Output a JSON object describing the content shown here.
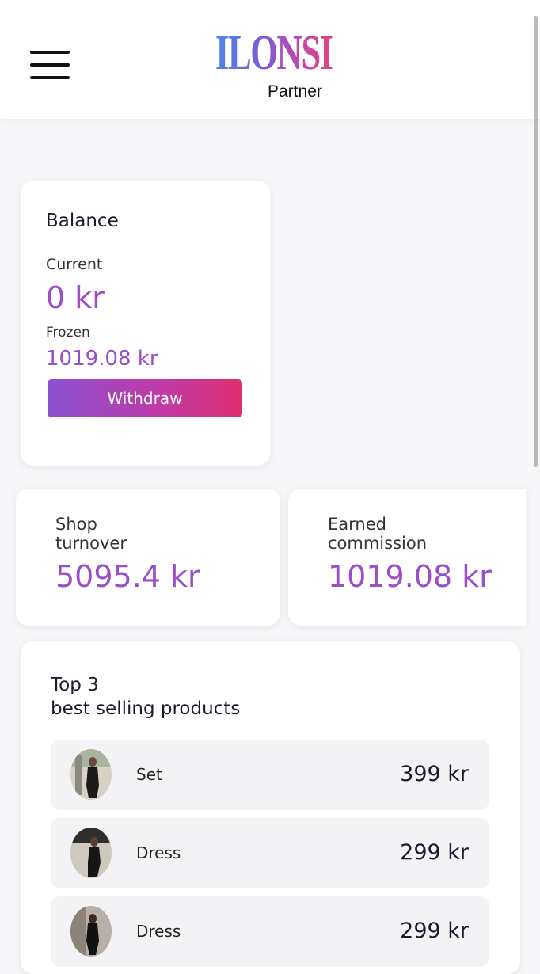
{
  "header": {
    "logo_text": "ILONSI",
    "logo_subtitle": "Partner",
    "menu_icon": "hamburger-menu-icon"
  },
  "balance": {
    "title": "Balance",
    "current_label": "Current",
    "current_value": "0 kr",
    "frozen_label": "Frozen",
    "frozen_value": "1019.08 kr",
    "withdraw_label": "Withdraw"
  },
  "stats": {
    "shop_turnover_label": "Shop\nturnover",
    "shop_turnover_value": "5095.4 kr",
    "commission_label": "Earned\ncommission",
    "commission_value": "1019.08 kr"
  },
  "top_products": {
    "title": "Top 3\nbest selling products",
    "items": [
      {
        "name": "Set",
        "price": "399 kr"
      },
      {
        "name": "Dress",
        "price": "299 kr"
      },
      {
        "name": "Dress",
        "price": "299 kr"
      }
    ]
  },
  "colors": {
    "accent_purple": "#9a4ec8",
    "gradient_start": "#8b52d1",
    "gradient_end": "#e0306f",
    "background": "#f7f7fa"
  }
}
